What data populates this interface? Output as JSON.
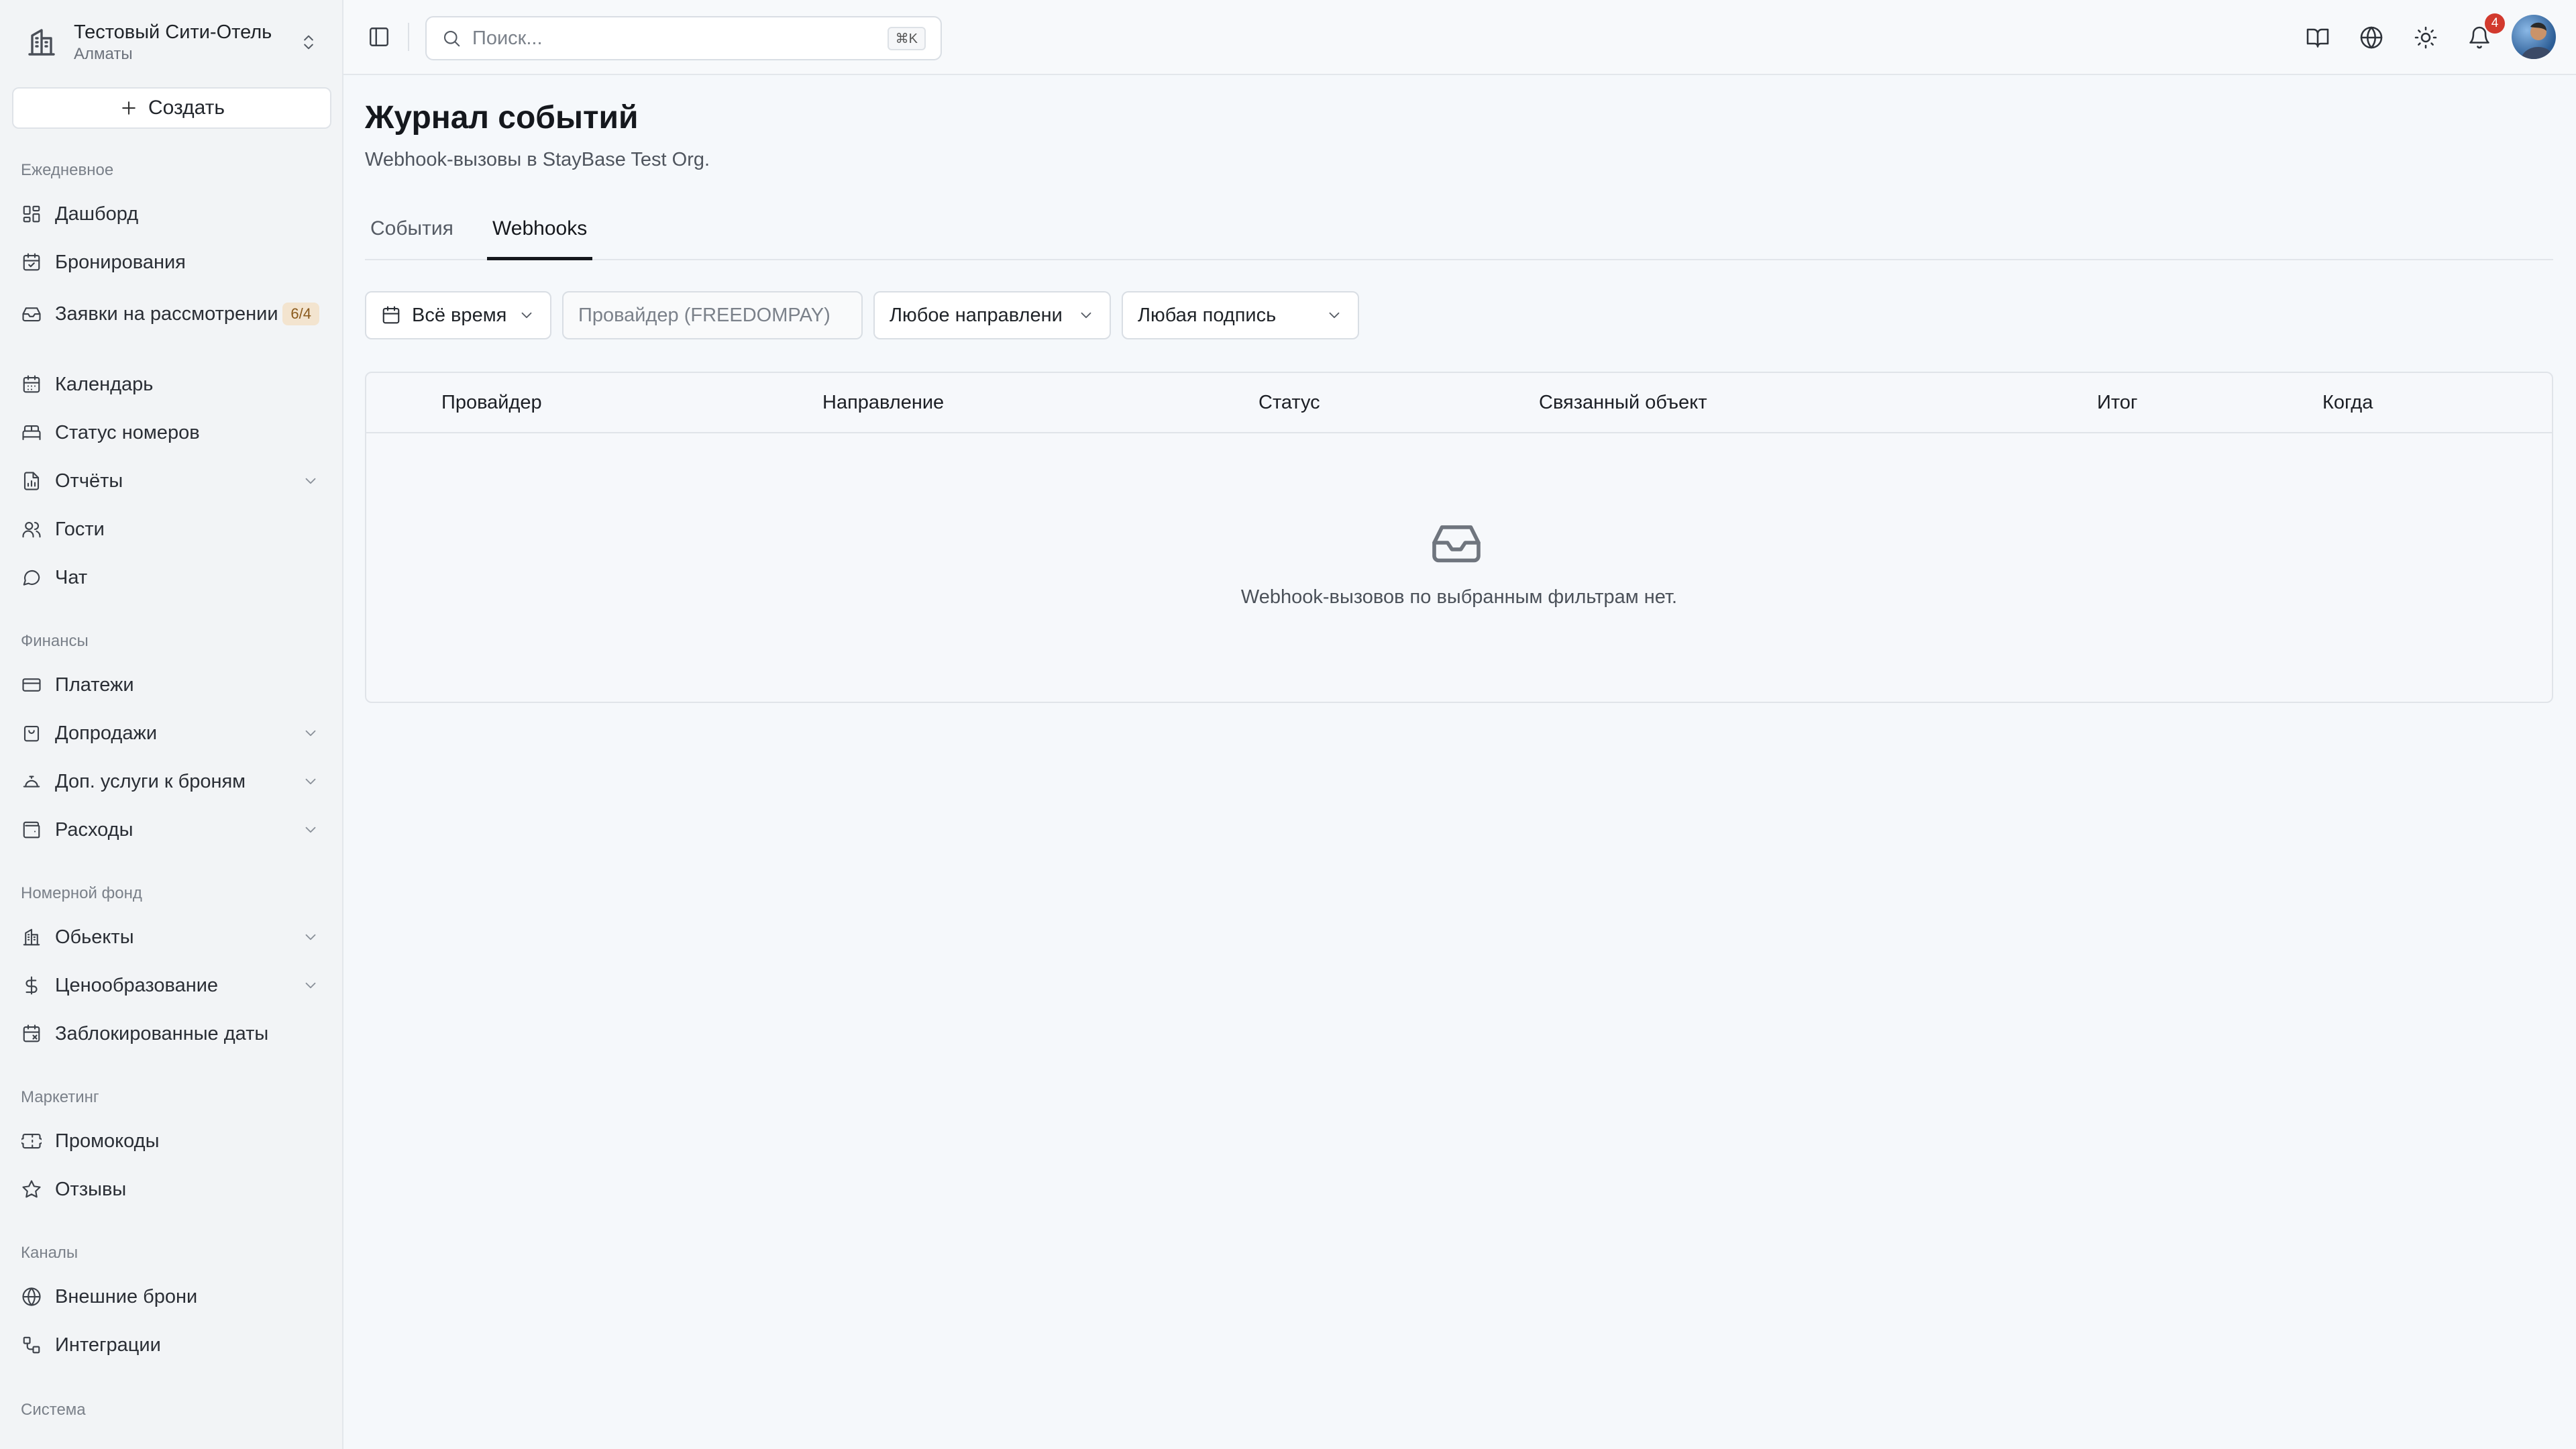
{
  "hotel": {
    "name": "Тестовый Сити-Отель",
    "city": "Алматы"
  },
  "create_label": "Создать",
  "sidebar": {
    "groups": [
      {
        "label": "Ежедневное"
      },
      {
        "label": "Финансы"
      },
      {
        "label": "Номерной фонд"
      },
      {
        "label": "Маркетинг"
      },
      {
        "label": "Каналы"
      },
      {
        "label": "Система"
      }
    ],
    "items": [
      {
        "label": "Дашборд"
      },
      {
        "label": "Бронирования"
      },
      {
        "label": "Заявки на рассмотрении",
        "badge": "6/4"
      },
      {
        "label": "Календарь"
      },
      {
        "label": "Статус номеров"
      },
      {
        "label": "Отчёты"
      },
      {
        "label": "Гости"
      },
      {
        "label": "Чат"
      },
      {
        "label": "Платежи"
      },
      {
        "label": "Допродажи"
      },
      {
        "label": "Доп. услуги к броням"
      },
      {
        "label": "Расходы"
      },
      {
        "label": "Обьекты"
      },
      {
        "label": "Ценообразование"
      },
      {
        "label": "Заблокированные даты"
      },
      {
        "label": "Промокоды"
      },
      {
        "label": "Отзывы"
      },
      {
        "label": "Внешние брони"
      },
      {
        "label": "Интеграции"
      }
    ]
  },
  "search": {
    "placeholder": "Поиск...",
    "shortcut": "⌘K"
  },
  "notifications": {
    "count": "4"
  },
  "page": {
    "title": "Журнал событий",
    "subtitle": "Webhook-вызовы в StayBase Test Org."
  },
  "tabs": [
    {
      "label": "События"
    },
    {
      "label": "Webhooks",
      "active": true
    }
  ],
  "filters": {
    "period": "Всё время",
    "provider_placeholder": "Провайдер (FREEDOMPAY)",
    "direction": "Любое направление",
    "signature": "Любая подпись"
  },
  "table": {
    "columns": [
      "Провайдер",
      "Направление",
      "Статус",
      "Связанный объект",
      "Итог",
      "Когда"
    ],
    "empty_message": "Webhook-вызовов по выбранным фильтрам нет."
  }
}
